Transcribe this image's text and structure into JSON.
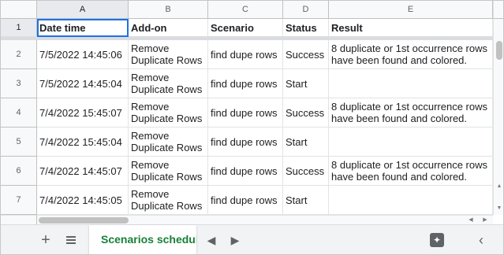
{
  "columns": [
    "A",
    "B",
    "C",
    "D",
    "E"
  ],
  "rows": [
    {
      "num": "1",
      "cells": [
        "Date time",
        "Add-on",
        "Scenario",
        "Status",
        "Result"
      ]
    },
    {
      "num": "2",
      "cells": [
        "7/5/2022 14:45:06",
        "Remove Duplicate Rows",
        "find dupe rows",
        "Success",
        "8 duplicate or 1st occurrence rows have been found and colored."
      ]
    },
    {
      "num": "3",
      "cells": [
        "7/5/2022 14:45:04",
        "Remove Duplicate Rows",
        "find dupe rows",
        "Start",
        ""
      ]
    },
    {
      "num": "4",
      "cells": [
        "7/4/2022 15:45:07",
        "Remove Duplicate Rows",
        "find dupe rows",
        "Success",
        "8 duplicate or 1st occurrence rows have been found and colored."
      ]
    },
    {
      "num": "5",
      "cells": [
        "7/4/2022 15:45:04",
        "Remove Duplicate Rows",
        "find dupe rows",
        "Start",
        ""
      ]
    },
    {
      "num": "6",
      "cells": [
        "7/4/2022 14:45:07",
        "Remove Duplicate Rows",
        "find dupe rows",
        "Success",
        "8 duplicate or 1st occurrence rows have been found and colored."
      ]
    },
    {
      "num": "7",
      "cells": [
        "7/4/2022 14:45:05",
        "Remove Duplicate Rows",
        "find dupe rows",
        "Start",
        ""
      ]
    }
  ],
  "tabbar": {
    "add_sheet_icon": "+",
    "sheet_tab_label": "Scenarios schedule",
    "prev_icon": "◀",
    "next_icon": "▶",
    "explore_icon": "✦",
    "collapse_icon": "‹"
  },
  "icons": {
    "add": "plus-icon",
    "list": "list-icon",
    "explore": "explore-icon",
    "collapse": "chevron-left-icon"
  },
  "colors": {
    "accent": "#1a73e8",
    "sheet_tab": "#188038"
  }
}
